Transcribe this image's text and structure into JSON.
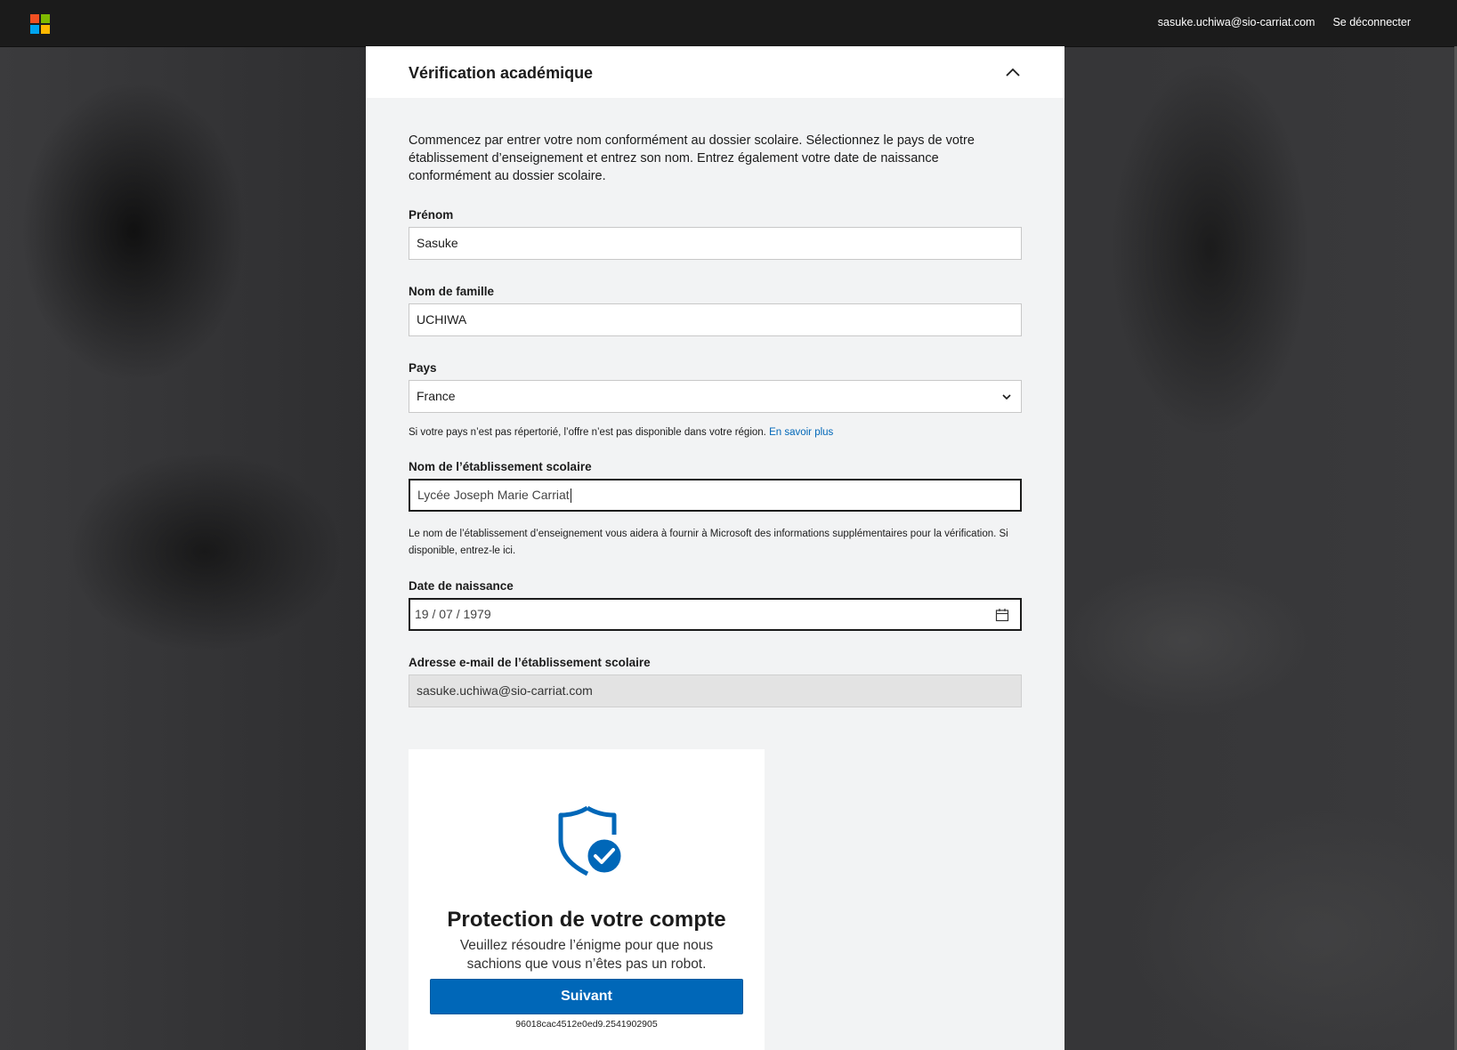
{
  "topbar": {
    "logo_icon": "microsoft-logo-icon",
    "user_email": "sasuke.uchiwa@sio-carriat.com",
    "signout_label": "Se déconnecter"
  },
  "panel": {
    "title": "Vérification académique",
    "collapse_icon": "chevron-up-icon",
    "intro": "Commencez par entrer votre nom conformément au dossier scolaire. Sélectionnez le pays de votre établissement d’enseignement et entrez son nom. Entrez également votre date de naissance conformément au dossier scolaire."
  },
  "form": {
    "first_name": {
      "label": "Prénom",
      "value": "Sasuke"
    },
    "last_name": {
      "label": "Nom de famille",
      "value": "UCHIWA"
    },
    "country": {
      "label": "Pays",
      "value": "France",
      "hint": "Si votre pays n’est pas répertorié, l’offre n’est pas disponible dans votre région.",
      "link": "En savoir plus"
    },
    "school": {
      "label": "Nom de l’établissement scolaire",
      "value": "Lycée Joseph Marie Carriat",
      "hint": "Le nom de l’établissement d’enseignement vous aidera à fournir à Microsoft des informations supplémentaires pour la vérification. Si disponible, entrez-le ici."
    },
    "birthdate": {
      "label": "Date de naissance",
      "value": "19 / 07 / 1979",
      "icon": "calendar-icon"
    },
    "school_email": {
      "label": "Adresse e-mail de l’établissement scolaire",
      "value": "sasuke.uchiwa@sio-carriat.com"
    }
  },
  "captcha": {
    "icon": "shield-check-icon",
    "title": "Protection de votre compte",
    "subtitle": "Veuillez résoudre l’énigme pour que nous sachions que vous n’êtes pas un robot.",
    "button_label": "Suivant",
    "session_id": "96018cac4512e0ed9.2541902905"
  },
  "colors": {
    "accent": "#0067b8",
    "topbar": "#1b1b1b",
    "panel": "#f2f3f4"
  }
}
